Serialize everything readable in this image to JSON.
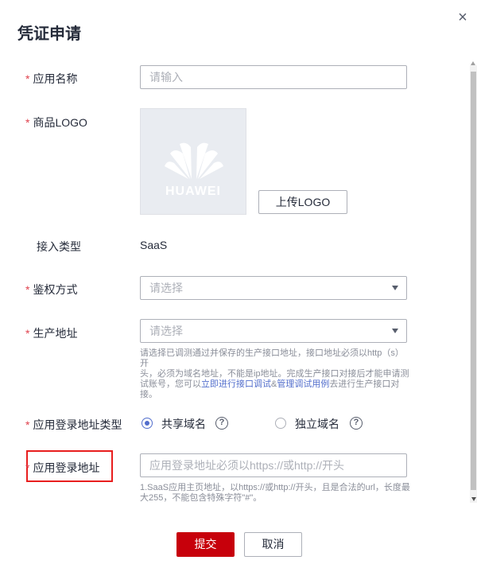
{
  "dialog": {
    "title": "凭证申请",
    "close_icon": "×"
  },
  "form": {
    "required_mark": "*",
    "app_name": {
      "label": "应用名称",
      "placeholder": "请输入"
    },
    "logo": {
      "label": "商品LOGO",
      "brand_text": "HUAWEI",
      "upload_label": "上传LOGO"
    },
    "access_type": {
      "label": "接入类型",
      "value": "SaaS"
    },
    "auth_method": {
      "label": "鉴权方式",
      "placeholder": "请选择"
    },
    "prod_address": {
      "label": "生产地址",
      "placeholder": "请选择",
      "help_line1": "请选择已调测通过并保存的生产接口地址，接口地址必须以http（s）开",
      "help_line2": "头，必须为域名地址，不能是ip地址。完成生产接口对接后才能申请测",
      "help_line3_pre": "试账号，您可以",
      "help_link1": "立即进行接口调试",
      "help_amp": "&",
      "help_link2": "管理调试用例",
      "help_line3_post": "去进行生产接口对",
      "help_line4": "接。"
    },
    "login_type": {
      "label": "应用登录地址类型",
      "option_shared": "共享域名",
      "option_independent": "独立域名",
      "selected": "共享域名",
      "help_glyph": "?"
    },
    "login_address": {
      "label": "应用登录地址",
      "placeholder": "应用登录地址必须以https://或http://开头",
      "help_line1": "1.SaaS应用主页地址，以https://或http://开头，且是合法的url，长度最",
      "help_line2": "大255，不能包含特殊字符\"#\"。"
    }
  },
  "footer": {
    "submit_label": "提交",
    "cancel_label": "取消"
  },
  "colors": {
    "accent": "#526ecc",
    "primary_button": "#c7000b",
    "required": "#e0414d",
    "highlight_box": "#e81e1e"
  }
}
